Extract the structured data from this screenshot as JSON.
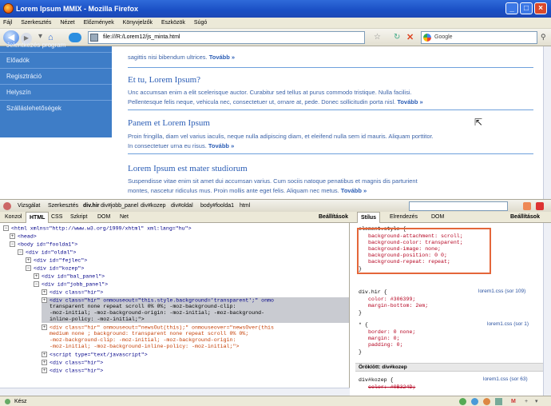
{
  "window": {
    "title": "Lorem Ipsum MMIX - Mozilla Firefox"
  },
  "menu": [
    "Fájl",
    "Szerkesztés",
    "Nézet",
    "Előzmények",
    "Könyvjelzők",
    "Eszközök",
    "Súgó"
  ],
  "nav": {
    "url": "file:///R:/Lorem12/js_minta.html",
    "search_placeholder": "Google"
  },
  "sidebar": {
    "items": [
      {
        "label": "Jelentkezés program"
      },
      {
        "label": "Előadók"
      },
      {
        "label": "Regisztráció"
      },
      {
        "label": "Helyszín"
      },
      {
        "label": "Szálláslehetőségek"
      }
    ]
  },
  "articles": {
    "intro": "sagittis nisi bibendum ultrices.",
    "more": "Tovább »",
    "a1": {
      "title": "Et tu, Lorem Ipsum?",
      "line1": "Unc accumsan enim a elit scelerisque auctor. Curabitur sed tellus at purus commodo tristique. Nulla facilisi.",
      "line2": "Pellentesque felis neque, vehicula nec, consectetuer ut, ornare at, pede. Donec sollicitudin porta nisl."
    },
    "a2": {
      "title": "Panem et Lorem Ipsum",
      "line1": "Proin fringilla, diam vel varius iaculis, neque nulla adipiscing diam, et eleifend nulla sem id mauris. Aliquam porttitor.",
      "line2": "In consectetuer urna eu risus."
    },
    "a3": {
      "title": "Lorem Ipsum est mater studiorum",
      "line1": "Suspendisse vitae enim sit amet dui accumsan varius. Cum sociis natoque penatibus et magnis dis parturient",
      "line2": "montes, nascetur ridiculus mus. Proin mollis ante eget felis. Aliquam nec metus."
    }
  },
  "firebug": {
    "breadcrumb": [
      "Vizsgálat",
      "Szerkesztés",
      "div.hir",
      "div#jobb_panel",
      "div#kozep",
      "div#oldal",
      "body#foolda1",
      "html"
    ],
    "left_tabs": [
      "Konzol",
      "HTML",
      "CSS",
      "Szkript",
      "DOM",
      "Net"
    ],
    "options_label": "Beállítások",
    "right_tabs": [
      "Stílus",
      "Elrendezés",
      "DOM"
    ],
    "html_lines": [
      "<html xmlns=\"http://www.w3.org/1999/xhtml\" xml:lang=\"hu\">",
      "<head>",
      "<body id=\"foolda1\">",
      "<div id=\"oldal\">",
      "<div id=\"fejlec\">",
      "<div id=\"kozep\">",
      "<div id=\"bal_panel\">",
      "<div id=\"jobb_panel\">",
      "<div class=\"hir\">",
      "<div class=\"hir\" onmouseout=\"this.style.background='transparent';\" onmo",
      "transparent none repeat scroll 0% 0%; -moz-background-clip:",
      "-moz-initial; -moz-background-origin: -moz-initial; -moz-background-",
      "inline-policy: -moz-initial;\">",
      "<div class=\"hir\" onmouseout=\"newsOut(this);\" onmouseover=\"newsOver(this",
      "medium none ; background: transparent none repeat scroll 0% 0%;",
      "-moz-background-clip: -moz-initial; -moz-background-origin:",
      "-moz-initial; -moz-background-inline-policy: -moz-initial;\">",
      "<script type=\"text/javascript\">",
      "<div class=\"hir\">",
      "<div class=\"hir\">"
    ],
    "style_element": "element.style {",
    "style_props": [
      "background-attachment: scroll;",
      "background-color: transparent;",
      "background-image: none;",
      "background-position: 0 0;",
      "background-repeat: repeat;"
    ],
    "rule1": {
      "selector": "div.hir {",
      "p1": "color: #306399;",
      "p2": "margin-bottom: 2em;",
      "src": "lorem1.css (sor 109)"
    },
    "rule2": {
      "selector": "* {",
      "p1": "border: 0 none;",
      "p2": "margin: 0;",
      "p3": "padding: 0;",
      "src": "lorem1.css (sor 1)"
    },
    "inherited": "Öröklött: div#kozep",
    "rule3": {
      "selector": "div#kozep {",
      "p1": "color: #0B324D;",
      "src": "lorem1.css (sor 63)"
    }
  },
  "status": {
    "text": "Kész"
  }
}
